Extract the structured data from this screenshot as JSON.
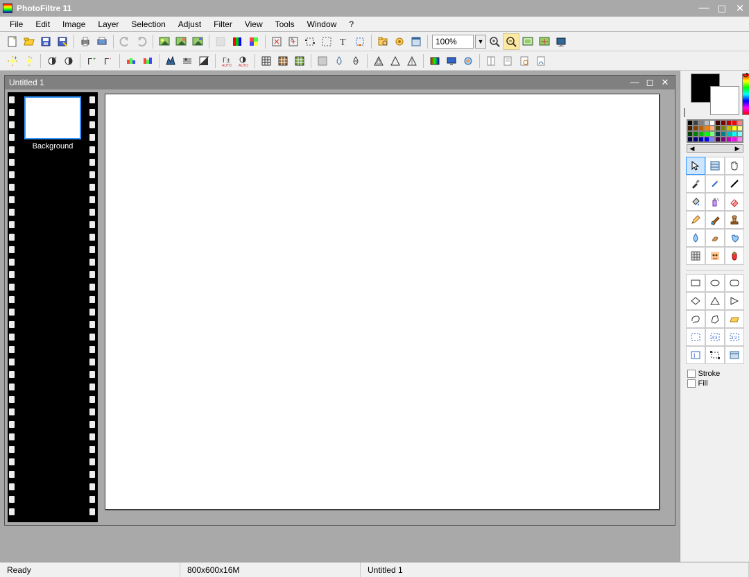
{
  "app": {
    "title": "PhotoFiltre 11"
  },
  "menu": [
    "File",
    "Edit",
    "Image",
    "Layer",
    "Selection",
    "Adjust",
    "Filter",
    "View",
    "Tools",
    "Window",
    "?"
  ],
  "toolbar1_icons": [
    "new",
    "open",
    "save",
    "save-as",
    "print",
    "twain",
    "undo",
    "redo",
    "img-a",
    "img-b",
    "img-c",
    "disabled",
    "rgb",
    "grid-a",
    "crop-a",
    "crop-b",
    "marquee",
    "sel-rect",
    "text",
    "attach",
    "browse",
    "plugin",
    "window-grid"
  ],
  "zoom": "100%",
  "toolbar1_icons_right": [
    "zoom-in",
    "zoom-out",
    "fit-a",
    "fit-b",
    "screen"
  ],
  "toolbar2_icons": [
    "bright-up",
    "bright-dn",
    "contrast-up",
    "contrast-dn",
    "gamma-up",
    "gamma-dn",
    "hue-a",
    "hue-b",
    "levels",
    "histogram",
    "invert",
    "auto-gamma",
    "auto-contrast",
    "grid3a",
    "grid3b",
    "grid3c",
    "sep",
    "drop-a",
    "drop-b",
    "sharpen",
    "tri-a",
    "tri-b",
    "colors",
    "monitor",
    "effect",
    "page-a",
    "page-b",
    "page-c",
    "page-d"
  ],
  "doc": {
    "title": "Untitled 1",
    "layer_label": "Background"
  },
  "palette_colors": [
    "#000000",
    "#404040",
    "#808080",
    "#c0c0c0",
    "#ffffff",
    "#400000",
    "#800000",
    "#c00000",
    "#ff0000",
    "#ff8080",
    "#402000",
    "#804000",
    "#c06000",
    "#ff8000",
    "#ffb080",
    "#404000",
    "#808000",
    "#c0c000",
    "#ffff00",
    "#ffff80",
    "#004000",
    "#008000",
    "#00c000",
    "#00ff00",
    "#80ff80",
    "#004040",
    "#008080",
    "#00c0c0",
    "#00ffff",
    "#80ffff",
    "#000040",
    "#000080",
    "#0000c0",
    "#0000ff",
    "#8080ff",
    "#400040",
    "#800080",
    "#c000c0",
    "#ff00ff",
    "#ff80ff"
  ],
  "tools": [
    "pointer",
    "grid-sel",
    "hand",
    "picker",
    "wand",
    "line",
    "bucket",
    "spray",
    "eraser",
    "pencil",
    "brush",
    "stamp",
    "drop",
    "smudge",
    "heal",
    "deform",
    "portrait",
    "strawberry"
  ],
  "shapes": [
    "rect",
    "ellipse",
    "round-rect",
    "diamond",
    "triangle",
    "triangle-r",
    "lasso",
    "polygon",
    "open-folder",
    "sel-a",
    "sel-43",
    "sel-32",
    "text-sel",
    "transform",
    "table"
  ],
  "options": {
    "stroke_label": "Stroke",
    "fill_label": "Fill"
  },
  "status": {
    "ready": "Ready",
    "dims": "800x600x16M",
    "file": "Untitled 1"
  }
}
